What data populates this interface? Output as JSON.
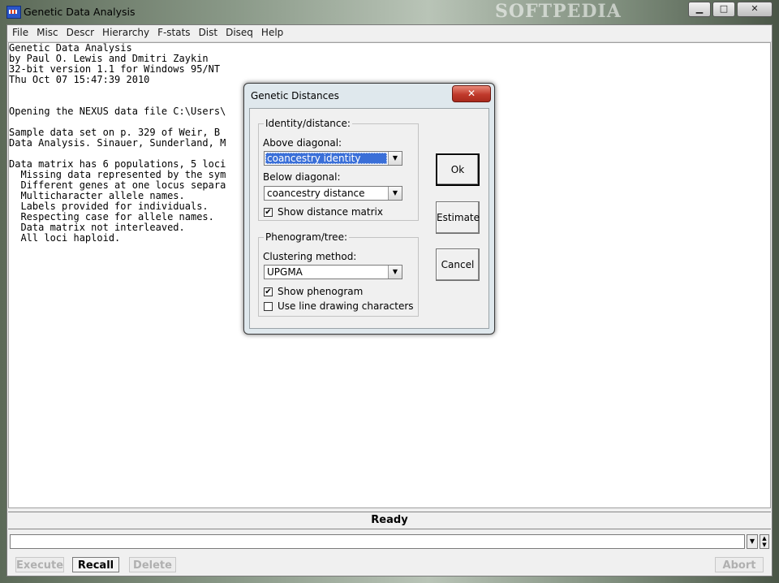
{
  "window": {
    "title": "Genetic Data Analysis",
    "watermark": "SOFTPEDIA",
    "minimize_glyph": "▁",
    "maximize_glyph": "□",
    "close_glyph": "✕"
  },
  "menu": [
    "File",
    "Misc",
    "Descr",
    "Hierarchy",
    "F-stats",
    "Dist",
    "Diseq",
    "Help"
  ],
  "output_lines": [
    "Genetic Data Analysis",
    "by Paul O. Lewis and Dmitri Zaykin",
    "32-bit version 1.1 for Windows 95/NT",
    "Thu Oct 07 15:47:39 2010",
    "",
    "",
    "Opening the NEXUS data file C:\\Users\\",
    "",
    "Sample data set on p. 329 of Weir, B",
    "Data Analysis. Sinauer, Sunderland, M",
    "",
    "Data matrix has 6 populations, 5 loci",
    "  Missing data represented by the sym",
    "  Different genes at one locus separa",
    "  Multicharacter allele names.",
    "  Labels provided for individuals.",
    "  Respecting case for allele names.",
    "  Data matrix not interleaved.",
    "  All loci haploid."
  ],
  "status": "Ready",
  "command": {
    "value": "",
    "buttons": {
      "execute": "Execute",
      "recall": "Recall",
      "delete": "Delete",
      "abort": "Abort"
    }
  },
  "dialog": {
    "title": "Genetic Distances",
    "close_glyph": "✕",
    "identity_group": {
      "label": "Identity/distance:",
      "above_label": "Above diagonal:",
      "above_value": "coancestry identity",
      "below_label": "Below diagonal:",
      "below_value": "coancestry distance",
      "show_matrix_label": "Show distance matrix",
      "show_matrix_checked": true
    },
    "tree_group": {
      "label": "Phenogram/tree:",
      "method_label": "Clustering method:",
      "method_value": "UPGMA",
      "show_phenogram_label": "Show phenogram",
      "show_phenogram_checked": true,
      "line_drawing_label": "Use line drawing characters",
      "line_drawing_checked": false
    },
    "buttons": {
      "ok": "Ok",
      "estimate": "Estimate",
      "cancel": "Cancel"
    }
  },
  "icons": {
    "dropdown_arrow": "▼",
    "check_mark": "✔",
    "scroll_up": "▲",
    "scroll_down": "▼"
  },
  "colors": {
    "selection": "#3a6fd8",
    "close_button": "#c0392b"
  }
}
